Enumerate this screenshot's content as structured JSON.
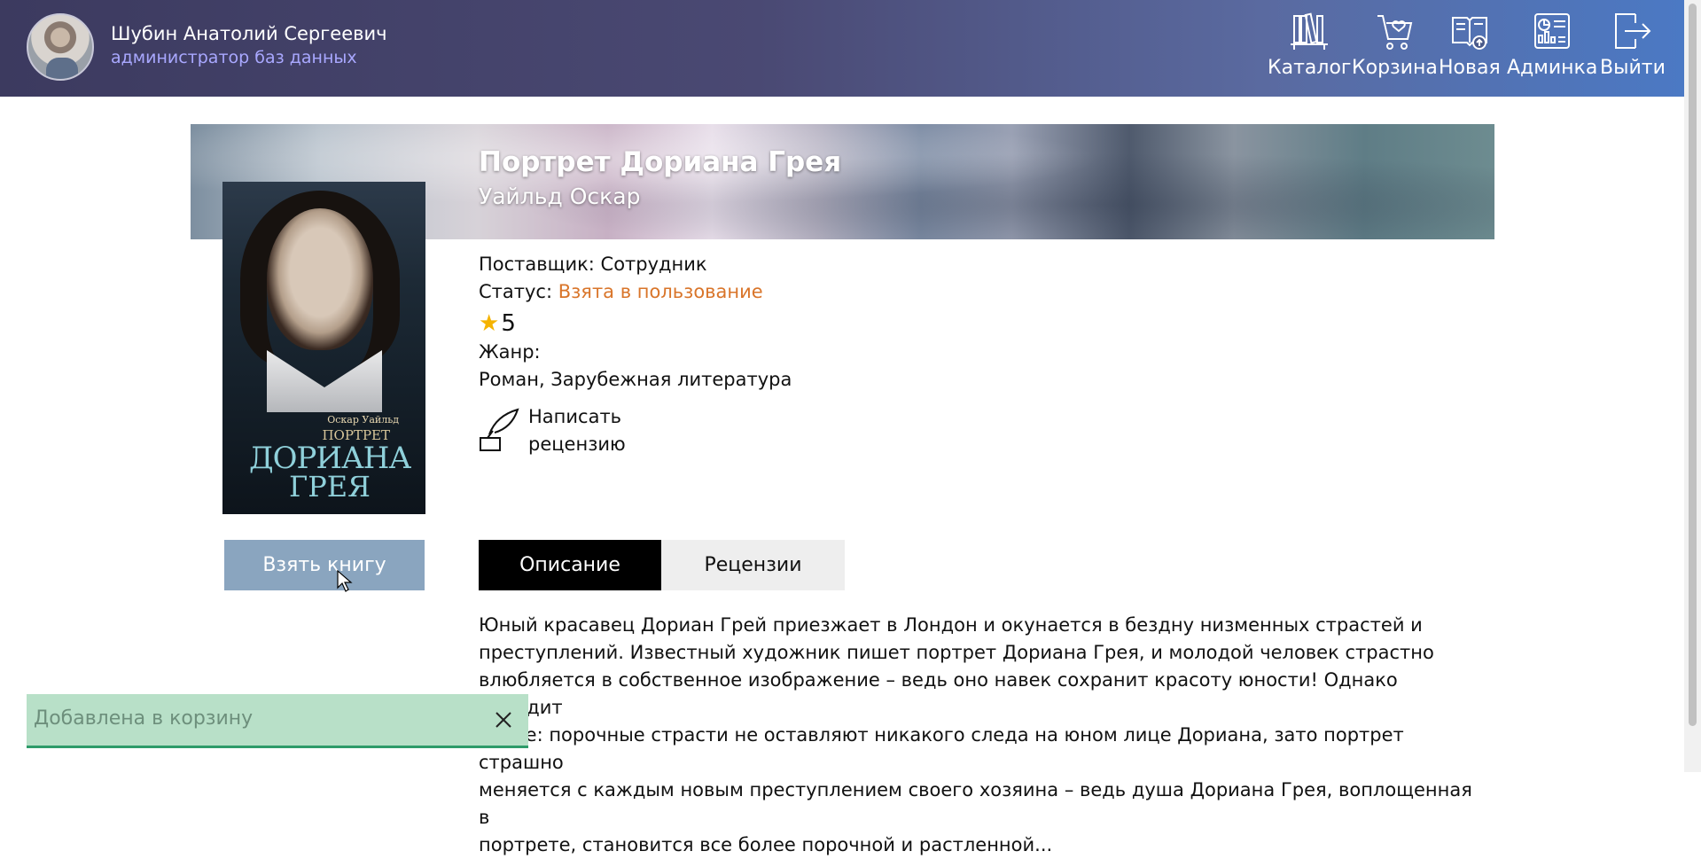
{
  "user": {
    "name": "Шубин Анатолий Сергеевич",
    "role": "администратор баз данных"
  },
  "nav": {
    "items": [
      {
        "label": "Каталог",
        "icon": "catalog-icon"
      },
      {
        "label": "Корзина",
        "icon": "cart-icon"
      },
      {
        "label": "Новая",
        "icon": "new-book-icon"
      },
      {
        "label": "Админка",
        "icon": "admin-icon"
      },
      {
        "label": "Выйти",
        "icon": "logout-icon"
      }
    ]
  },
  "book": {
    "title": "Портрет Дориана Грея",
    "author": "Уайльд Оскар",
    "cover": {
      "author": "Оскар Уайльд",
      "line1": "ПОРТРЕТ",
      "line2": "ДОРИАНА",
      "line3": "ГРЕЯ"
    },
    "supplier_label": "Поставщик: Сотрудник",
    "status_label": "Статус: ",
    "status_value": "Взята в пользование",
    "rating": "5",
    "genre_label": "Жанр:",
    "genres": "Роман, Зарубежная литература",
    "review_label_1": "Написать",
    "review_label_2": "рецензию",
    "take_button": "Взять книгу"
  },
  "tabs": {
    "description": "Описание",
    "reviews": "Рецензии",
    "active": "description"
  },
  "description": {
    "line1": "Юный красавец Дориан Грей приезжает в Лондон и окунается в бездну низменных страстей и",
    "line2": "преступлений. Известный художник пишет портрет Дориана Грея, и молодой человек страстно",
    "line3": "влюбляется в собственное изображение – ведь оно навек сохранит красоту юности! Однако выходит",
    "line4": "иначе: порочные страсти не оставляют никакого следа на юном лице Дориана, зато портрет страшно",
    "line5": "меняется с каждым новым преступлением своего хозяина – ведь душа Дориана Грея, воплощенная в",
    "line6": "портрете, становится все более порочной и растленной..."
  },
  "toast": {
    "text": "Добавлена в корзину"
  },
  "colors": {
    "status": "#d9752a",
    "header_start": "#3c3a5f",
    "header_end": "#4b79c4",
    "toast_bg": "#b8e0c8",
    "take_button_bg": "#8aa5bf"
  }
}
